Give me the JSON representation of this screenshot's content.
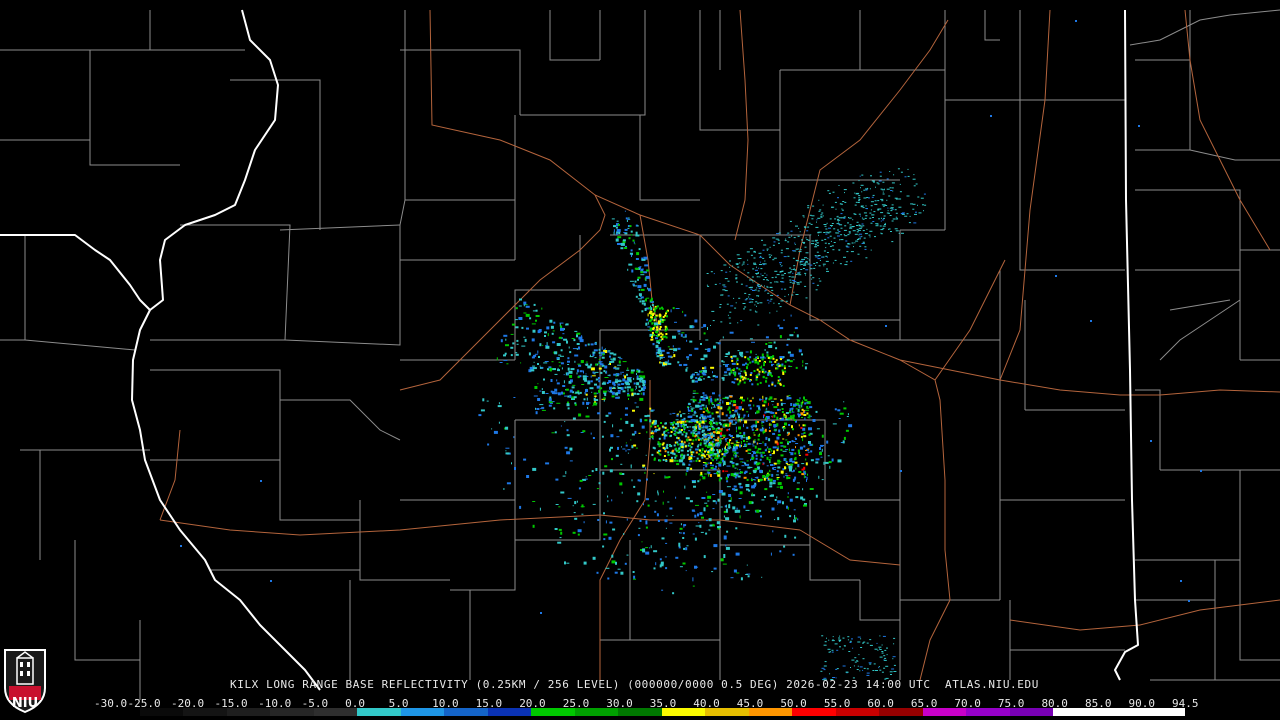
{
  "product": {
    "caption": "KILX LONG RANGE BASE REFLECTIVITY (0.25KM / 256 LEVEL) (000000/0000 0.5 DEG) 2026-02-23 14:00 UTC  ATLAS.NIU.EDU"
  },
  "logo": {
    "text": "NIU",
    "icon": "niu-tower-logo-icon"
  },
  "scale": {
    "ticks": [
      "-30.0",
      "-25.0",
      "-20.0",
      "-15.0",
      "-10.0",
      "-5.0",
      "0.0",
      "5.0",
      "10.0",
      "15.0",
      "20.0",
      "25.0",
      "30.0",
      "35.0",
      "40.0",
      "45.0",
      "50.0",
      "55.0",
      "60.0",
      "65.0",
      "70.0",
      "75.0",
      "80.0",
      "85.0",
      "90.0",
      "94.5"
    ],
    "colors": [
      "#000000",
      "#0a0a0a",
      "#141414",
      "#1e1e1e",
      "#262626",
      "#2e2e2e",
      "#32c8c8",
      "#1e96e6",
      "#1464c8",
      "#0a32b4",
      "#00c800",
      "#00a000",
      "#007800",
      "#fafa00",
      "#e6be00",
      "#ff9600",
      "#ff0000",
      "#c80000",
      "#960000",
      "#c800c8",
      "#9600c8",
      "#7800b4",
      "#ffffff",
      "#ffffff",
      "#ffffff"
    ]
  },
  "palette": {
    "state_border": "#ffffff",
    "county_border": "#8c8c8c",
    "highway": "#b4643c",
    "echo_light": "#32c8c8",
    "echo_mid": "#1e78e6",
    "echo_green": "#00c800",
    "echo_yellow": "#fafa00",
    "echo_orange": "#ff9600",
    "echo_red": "#ff0000"
  }
}
